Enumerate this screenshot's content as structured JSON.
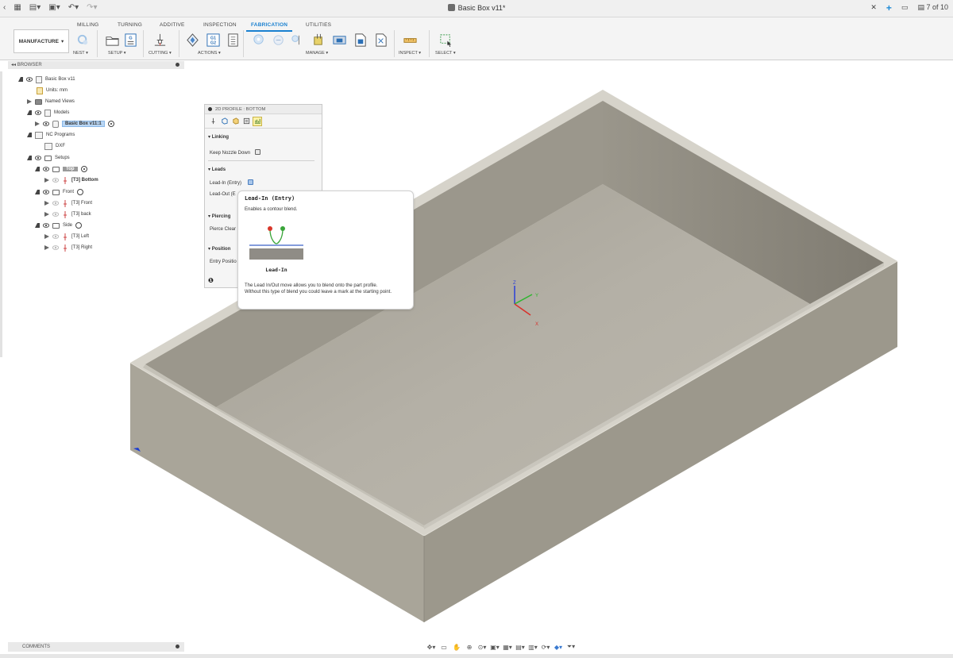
{
  "titlebar": {
    "document_title": "Basic Box v11*",
    "page_counter": "7 of 10"
  },
  "ribbon": {
    "workspace": "MANUFACTURE",
    "tabs": [
      "MILLING",
      "TURNING",
      "ADDITIVE",
      "INSPECTION",
      "FABRICATION",
      "UTILITIES"
    ],
    "active_tab": "FABRICATION",
    "groups": {
      "nest": "NEST",
      "setup": "SETUP",
      "cutting": "CUTTING",
      "actions": "ACTIONS",
      "manage": "MANAGE",
      "inspect": "INSPECT",
      "select": "SELECT"
    },
    "post_icon_text": "G1\nG2",
    "setup_icon_text": "G"
  },
  "browser": {
    "header": "BROWSER",
    "items": [
      {
        "label": "Basic Box v11"
      },
      {
        "label": "Units: mm"
      },
      {
        "label": "Named Views"
      },
      {
        "label": "Models"
      },
      {
        "label": "Basic Box v11:1"
      },
      {
        "label": "NC Programs"
      },
      {
        "label": "DXF"
      },
      {
        "label": "Setups"
      },
      {
        "label": "Top"
      },
      {
        "label": "[T3] Bottom"
      },
      {
        "label": "Front"
      },
      {
        "label": "[T3] Front"
      },
      {
        "label": "[T3] back"
      },
      {
        "label": "Side"
      },
      {
        "label": "[T3] Left"
      },
      {
        "label": "[T3] Right"
      }
    ]
  },
  "dialog": {
    "title": "2D PROFILE : BOTTOM",
    "sections": {
      "linking": "Linking",
      "keep_nozzle_down": "Keep Nozzle Down",
      "leads": "Leads",
      "lead_in": "Lead-In (Entry)",
      "lead_out": "Lead-Out (E",
      "piercing": "Piercing",
      "pierce_clearance": "Pierce Clear",
      "positions": "Position",
      "entry_positions": "Entry Positio"
    }
  },
  "tooltip": {
    "title": "Lead-In (Entry)",
    "subtitle": "Enables a contour blend.",
    "figure_label": "Lead-In",
    "body_line1": "The Lead In/Out move allows you to blend onto the part profile.",
    "body_line2": "Without this type of blend you could leave a mark at the starting point."
  },
  "triad": {
    "z": "Z",
    "y": "Y",
    "x": "X"
  },
  "comments": {
    "label": "COMMENTS"
  },
  "colors": {
    "accent": "#1a80d0",
    "box_top_rim": "#d4d1c8",
    "box_floor": "#b6b2a7",
    "box_front": "#aca89c",
    "box_side": "#999589",
    "lead_red": "#d9372a",
    "lead_green": "#3aa53a"
  }
}
